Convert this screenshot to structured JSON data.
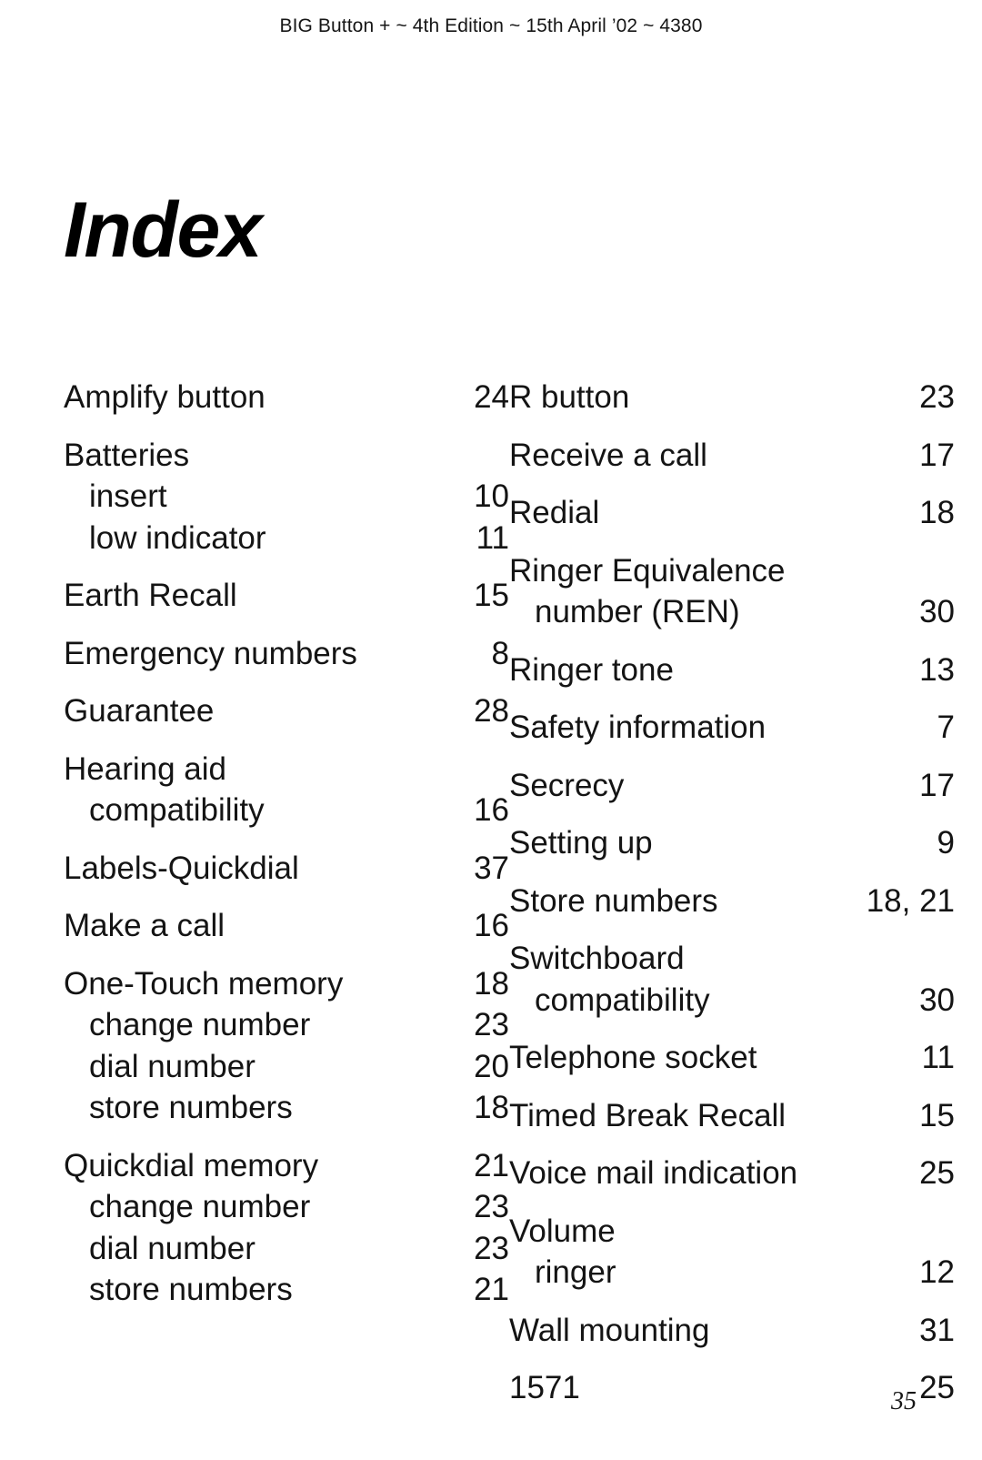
{
  "header": {
    "running_head": "BIG Button +  ~ 4th Edition ~ 15th April ’02 ~ 4380"
  },
  "title": "Index",
  "footer": {
    "page_number": "35"
  },
  "index": {
    "left_column": [
      {
        "label": "Amplify button",
        "page": "24",
        "level": "main"
      },
      {
        "label": "Batteries",
        "page": "",
        "level": "main"
      },
      {
        "label": "insert",
        "page": "10",
        "level": "sub"
      },
      {
        "label": "low indicator",
        "page": "11",
        "level": "sub"
      },
      {
        "label": "Earth Recall",
        "page": "15",
        "level": "main"
      },
      {
        "label": "Emergency numbers",
        "page": "8",
        "level": "main"
      },
      {
        "label": "Guarantee",
        "page": "28",
        "level": "main"
      },
      {
        "label": "Hearing aid",
        "page": "",
        "level": "main"
      },
      {
        "label": "compatibility",
        "page": "16",
        "level": "cont"
      },
      {
        "label": "Labels-Quickdial",
        "page": "37",
        "level": "main"
      },
      {
        "label": "Make a call",
        "page": "16",
        "level": "main"
      },
      {
        "label": "One-Touch memory",
        "page": "18",
        "level": "main"
      },
      {
        "label": "change number",
        "page": "23",
        "level": "sub"
      },
      {
        "label": "dial number",
        "page": "20",
        "level": "sub"
      },
      {
        "label": "store numbers",
        "page": "18",
        "level": "sub"
      },
      {
        "label": "Quickdial memory",
        "page": "21",
        "level": "main"
      },
      {
        "label": "change number",
        "page": "23",
        "level": "sub"
      },
      {
        "label": "dial number",
        "page": "23",
        "level": "sub"
      },
      {
        "label": "store numbers",
        "page": "21",
        "level": "sub"
      }
    ],
    "right_column": [
      {
        "label": "R button",
        "page": "23",
        "level": "main"
      },
      {
        "label": "Receive a call",
        "page": "17",
        "level": "main"
      },
      {
        "label": "Redial",
        "page": "18",
        "level": "main"
      },
      {
        "label": "Ringer Equivalence",
        "page": "",
        "level": "main"
      },
      {
        "label": "number (REN)",
        "page": "30",
        "level": "cont"
      },
      {
        "label": "Ringer tone",
        "page": "13",
        "level": "main"
      },
      {
        "label": "Safety information",
        "page": "7",
        "level": "main"
      },
      {
        "label": "Secrecy",
        "page": "17",
        "level": "main"
      },
      {
        "label": "Setting up",
        "page": "9",
        "level": "main"
      },
      {
        "label": "Store numbers",
        "page": "18, 21",
        "level": "main"
      },
      {
        "label": "Switchboard",
        "page": "",
        "level": "main"
      },
      {
        "label": "compatibility",
        "page": "30",
        "level": "cont"
      },
      {
        "label": "Telephone socket",
        "page": "11",
        "level": "main"
      },
      {
        "label": "Timed Break Recall",
        "page": "15",
        "level": "main"
      },
      {
        "label": "Voice mail indication",
        "page": "25",
        "level": "main"
      },
      {
        "label": "Volume",
        "page": "",
        "level": "main"
      },
      {
        "label": "ringer",
        "page": "12",
        "level": "cont"
      },
      {
        "label": "Wall mounting",
        "page": "31",
        "level": "main"
      },
      {
        "label": "1571",
        "page": "25",
        "level": "main"
      }
    ]
  }
}
